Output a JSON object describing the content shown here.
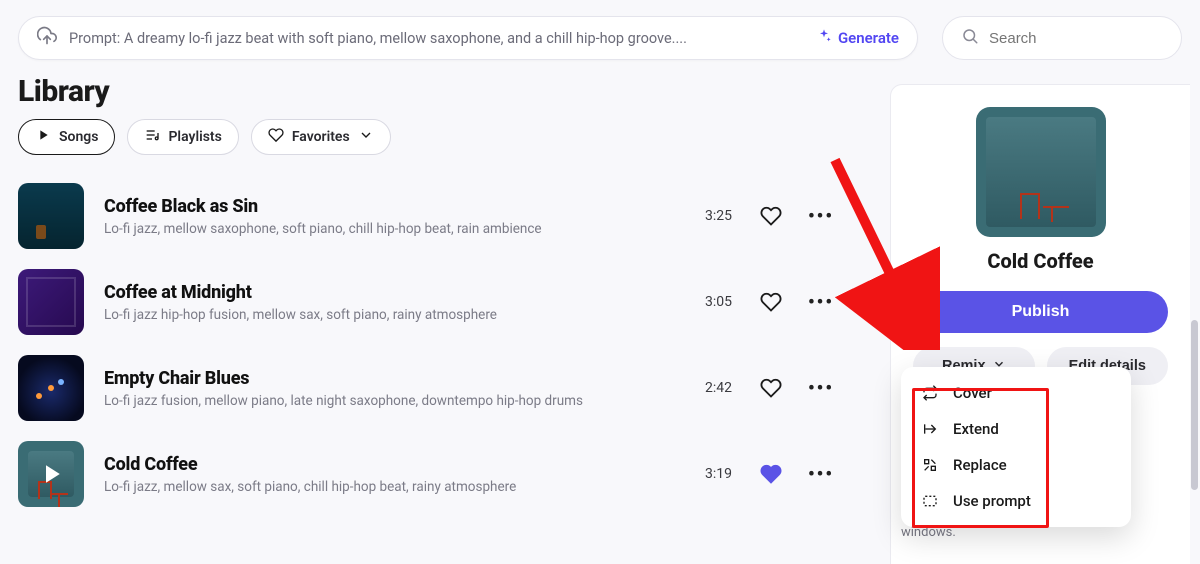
{
  "topbar": {
    "prompt_text": "Prompt: A dreamy lo-fi jazz beat with soft piano, mellow saxophone, and a chill hip-hop groove....",
    "generate_label": "Generate",
    "search_placeholder": "Search"
  },
  "library": {
    "heading": "Library",
    "tabs": {
      "songs": "Songs",
      "playlists": "Playlists",
      "favorites": "Favorites"
    }
  },
  "tracks": [
    {
      "title": "Coffee Black as Sin",
      "sub": "Lo-fi jazz, mellow saxophone, soft piano, chill hip-hop beat, rain ambience",
      "duration": "3:25",
      "liked": false,
      "playing": false
    },
    {
      "title": "Coffee at Midnight",
      "sub": "Lo-fi jazz hip-hop fusion, mellow sax, soft piano, rainy atmosphere",
      "duration": "3:05",
      "liked": false,
      "playing": false
    },
    {
      "title": "Empty Chair Blues",
      "sub": "Lo-fi jazz fusion, mellow piano, late night saxophone, downtempo hip-hop drums",
      "duration": "2:42",
      "liked": false,
      "playing": false
    },
    {
      "title": "Cold Coffee",
      "sub": "Lo-fi jazz, mellow sax, soft piano, chill hip-hop beat, rainy atmosphere",
      "duration": "3:19",
      "liked": true,
      "playing": true
    }
  ],
  "detail": {
    "title": "Cold Coffee",
    "publish_label": "Publish",
    "remix_label": "Remix",
    "edit_label": "Edit details",
    "windows_tail": "windows."
  },
  "remix_menu": [
    "Cover",
    "Extend",
    "Replace",
    "Use prompt"
  ]
}
